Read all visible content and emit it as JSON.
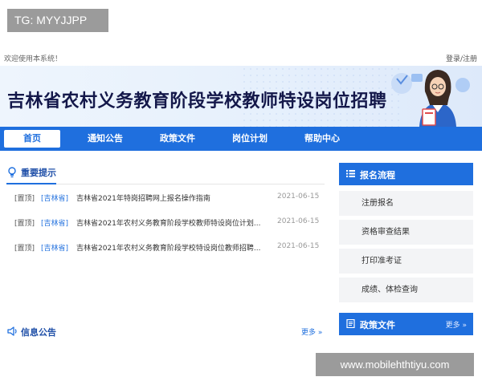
{
  "overlays": {
    "top_tag": "TG: MYYJJPP",
    "bottom_url": "www.mobilehthtiyu.com"
  },
  "topbar": {
    "welcome": "欢迎使用本系统！",
    "login": "登录/注册"
  },
  "banner": {
    "title": "吉林省农村义务教育阶段学校教师特设岗位招聘"
  },
  "nav": {
    "items": [
      {
        "label": "首页",
        "active": true
      },
      {
        "label": "通知公告"
      },
      {
        "label": "政策文件"
      },
      {
        "label": "岗位计划"
      },
      {
        "label": "帮助中心"
      }
    ]
  },
  "notice": {
    "title": "重要提示",
    "rows": [
      {
        "tag1": "[置顶]",
        "tag2": "[吉林省]",
        "headline": "吉林省2021年特岗招聘网上报名操作指南",
        "date": "2021-06-15"
      },
      {
        "tag1": "[置顶]",
        "tag2": "[吉林省]",
        "headline": "吉林省2021年农村义务教育阶段学校教师特设岗位计划...",
        "date": "2021-06-15"
      },
      {
        "tag1": "[置顶]",
        "tag2": "[吉林省]",
        "headline": "吉林省2021年农村义务教育阶段学校特设岗位教师招聘...",
        "date": "2021-06-15"
      }
    ]
  },
  "info": {
    "title": "信息公告",
    "more": "更多 »"
  },
  "flow": {
    "title": "报名流程",
    "items": [
      "注册报名",
      "资格审查结果",
      "打印准考证",
      "成绩、体检查询"
    ]
  },
  "policy": {
    "title": "政策文件",
    "more": "更多 »"
  },
  "colors": {
    "primary": "#1f6fde",
    "heading": "#1f4fa8",
    "panel_bg": "#f3f4f6"
  }
}
